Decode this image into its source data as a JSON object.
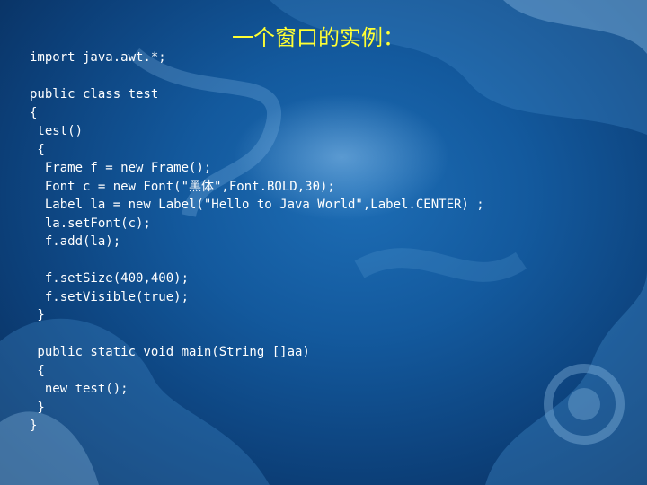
{
  "slide": {
    "title": "一个窗口的实例：",
    "code_lines": [
      "import java.awt.*;",
      "",
      "public class test",
      "{",
      " test()",
      " {",
      "  Frame f = new Frame();",
      "  Font c = new Font(\"黑体\",Font.BOLD,30);",
      "  Label la = new Label(\"Hello to Java World\",Label.CENTER) ;",
      "  la.setFont(c);",
      "  f.add(la);",
      "",
      "  f.setSize(400,400);",
      "  f.setVisible(true);",
      " }",
      "",
      " public static void main(String []aa)",
      " {",
      "  new test();",
      " }",
      "}"
    ]
  },
  "colors": {
    "background": "#13599d",
    "title": "#ffff33",
    "code_text": "#ffffff"
  }
}
